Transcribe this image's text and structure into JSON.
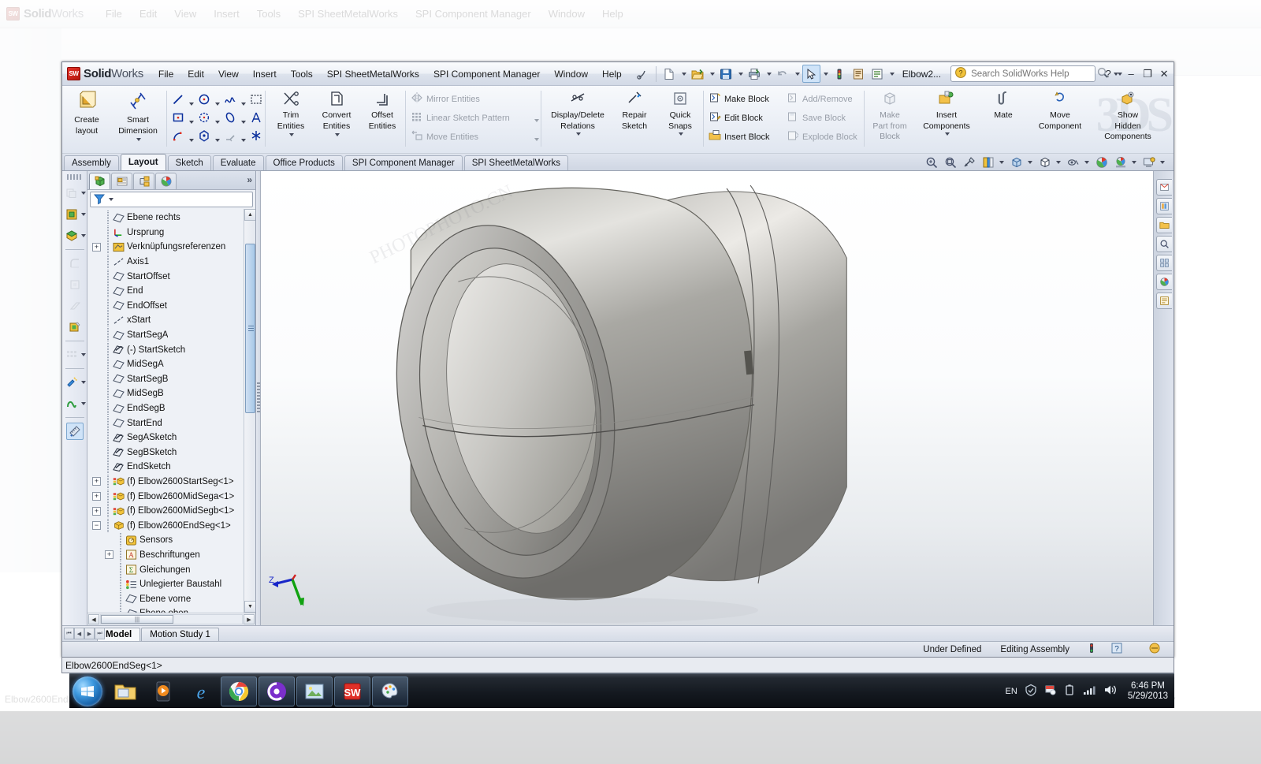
{
  "app": {
    "brand_bold": "Solid",
    "brand_light": "Works",
    "logo_badge": "SW",
    "document_name": "Elbow2...",
    "status_doc_name": "Elbow2600EndSeg<1>"
  },
  "menubar": {
    "items": [
      "File",
      "Edit",
      "View",
      "Insert",
      "Tools",
      "SPI SheetMetalWorks",
      "SPI Component Manager",
      "Window",
      "Help"
    ]
  },
  "quick_access": {
    "buttons": [
      {
        "name": "new-document",
        "icon": "new-doc-icon"
      },
      {
        "name": "open-document",
        "icon": "open-folder-icon"
      },
      {
        "name": "save-document",
        "icon": "save-disk-icon"
      },
      {
        "name": "print-document",
        "icon": "printer-icon"
      },
      {
        "name": "undo",
        "icon": "undo-arrow-icon"
      },
      {
        "name": "select",
        "icon": "cursor-arrow-icon"
      },
      {
        "name": "rebuild",
        "icon": "traffic-light-icon"
      },
      {
        "name": "options-toolbar",
        "icon": "clipboard-icon"
      },
      {
        "name": "options",
        "icon": "options-list-icon"
      }
    ]
  },
  "search": {
    "placeholder": "Search SolidWorks Help",
    "value": "",
    "icon": "help-search-icon"
  },
  "window_controls": {
    "help": "?",
    "minimize": "–",
    "restore": "❐",
    "close": "✕"
  },
  "ribbon": {
    "watermark": "3DS",
    "groups": [
      {
        "name": "layout-group",
        "big_buttons": [
          {
            "label": "Create\nlayout",
            "line1": "Create",
            "line2": "layout",
            "icon": "create-layout-icon",
            "has_caret": false
          },
          {
            "label": "Smart Dimension",
            "line1": "Smart",
            "line2": "Dimension",
            "icon": "smart-dimension-icon",
            "has_caret": true
          }
        ]
      },
      {
        "name": "sketch-entities-group",
        "grid_icons": [
          [
            "line-icon",
            "circle-icon",
            "spline-icon",
            "selection-box-icon"
          ],
          [
            "rectangle-icon",
            "polygon-arc-icon",
            "ellipse-icon",
            "text-icon"
          ],
          [
            "sketch-fillet-icon",
            "point-icon",
            "sketch-chamfer-icon",
            "sketch-pattern-star-icon"
          ]
        ]
      },
      {
        "name": "edit-entities-group",
        "big_buttons": [
          {
            "line1": "Trim",
            "line2": "Entities",
            "icon": "trim-entities-icon",
            "has_caret": true
          },
          {
            "line1": "Convert",
            "line2": "Entities",
            "icon": "convert-entities-icon",
            "has_caret": true
          },
          {
            "line1": "Offset",
            "line2": "Entities",
            "icon": "offset-entities-icon",
            "has_caret": false
          }
        ]
      },
      {
        "name": "pattern-group",
        "small_buttons": [
          {
            "label": "Mirror Entities",
            "icon": "mirror-entities-icon",
            "disabled": true,
            "caret": false
          },
          {
            "label": "Linear Sketch Pattern",
            "icon": "linear-sketch-pattern-icon",
            "disabled": true,
            "caret": true
          },
          {
            "label": "Move Entities",
            "icon": "move-entities-icon",
            "disabled": true,
            "caret": true
          }
        ]
      },
      {
        "name": "relations-group",
        "big_buttons": [
          {
            "line1": "Display/Delete",
            "line2": "Relations",
            "icon": "display-delete-relations-icon",
            "has_caret": true
          },
          {
            "line1": "Repair",
            "line2": "Sketch",
            "icon": "repair-sketch-icon",
            "has_caret": false
          },
          {
            "line1": "Quick",
            "line2": "Snaps",
            "icon": "quick-snaps-icon",
            "has_caret": true
          }
        ]
      },
      {
        "name": "blocks-group",
        "small_buttons": [
          {
            "label": "Make Block",
            "icon": "make-block-icon",
            "disabled": false
          },
          {
            "label": "Add/Remove",
            "icon": "add-remove-block-icon",
            "disabled": true
          },
          {
            "label": "Edit Block",
            "icon": "edit-block-icon",
            "disabled": false
          },
          {
            "label": "Save Block",
            "icon": "save-block-icon",
            "disabled": true
          },
          {
            "label": "Insert Block",
            "icon": "insert-block-icon",
            "disabled": false
          },
          {
            "label": "Explode Block",
            "icon": "explode-block-icon",
            "disabled": true
          }
        ]
      },
      {
        "name": "assembly-group",
        "big_buttons": [
          {
            "line1": "Make",
            "line2": "Part from",
            "line3": "Block",
            "icon": "make-part-from-block-icon",
            "has_caret": false,
            "disabled": true
          },
          {
            "line1": "Insert",
            "line2": "Components",
            "icon": "insert-components-icon",
            "has_caret": true
          },
          {
            "line1": "Mate",
            "line2": "",
            "icon": "mate-icon",
            "has_caret": false
          },
          {
            "line1": "Move",
            "line2": "Component",
            "icon": "move-component-icon",
            "has_caret": false
          },
          {
            "line1": "Show",
            "line2": "Hidden",
            "line3": "Components",
            "icon": "show-hidden-components-icon",
            "has_caret": false
          }
        ]
      }
    ]
  },
  "command_tabs": {
    "tabs": [
      {
        "label": "Assembly",
        "active": false
      },
      {
        "label": "Layout",
        "active": true
      },
      {
        "label": "Sketch",
        "active": false
      },
      {
        "label": "Evaluate",
        "active": false
      },
      {
        "label": "Office Products",
        "active": false
      },
      {
        "label": "SPI Component Manager",
        "active": false
      },
      {
        "label": "SPI SheetMetalWorks",
        "active": false
      }
    ],
    "view_toolbar_icons": [
      "zoom-to-fit-icon",
      "zoom-to-area-icon",
      "previous-view-icon",
      "section-view-icon",
      "view-orientation-icon",
      "display-style-icon",
      "hide-show-items-icon",
      "edit-appearance-icon",
      "apply-scene-icon",
      "view-settings-icon"
    ]
  },
  "left_rail": {
    "buttons": [
      {
        "name": "assembly-features-icon",
        "disabled": true,
        "caret": true
      },
      {
        "name": "reference-geometry-icon",
        "disabled": false,
        "caret": true
      },
      {
        "name": "new-motion-study-icon",
        "disabled": false,
        "caret": true
      },
      {
        "name": "fillet-icon",
        "disabled": true,
        "caret": false
      },
      {
        "name": "extrude-cut-icon",
        "disabled": true,
        "caret": false
      },
      {
        "name": "revolve-cut-icon",
        "disabled": true,
        "caret": false
      },
      {
        "name": "instant3d-icon",
        "disabled": false,
        "caret": false
      },
      {
        "name": "linear-component-pattern-icon",
        "disabled": true,
        "caret": true
      },
      {
        "name": "smart-fasteners-icon",
        "disabled": false,
        "caret": true
      },
      {
        "name": "belt-chain-icon",
        "disabled": false,
        "caret": true
      },
      {
        "name": "measure-icon",
        "disabled": false,
        "caret": false,
        "selected": true
      }
    ]
  },
  "feature_manager": {
    "tabs": [
      {
        "name": "feature-manager-design-tree-tab",
        "icon": "design-tree-icon",
        "active": true
      },
      {
        "name": "property-manager-tab",
        "icon": "property-manager-icon",
        "active": false
      },
      {
        "name": "configuration-manager-tab",
        "icon": "configuration-manager-icon",
        "active": false
      },
      {
        "name": "display-manager-tab",
        "icon": "display-manager-icon",
        "active": false
      }
    ],
    "more_tabs": "»",
    "filter_icon": "filter-funnel-icon",
    "tree": [
      {
        "label": "Ebene rechts",
        "icon": "plane-icon",
        "indent": 1,
        "expand": "none"
      },
      {
        "label": "Ursprung",
        "icon": "origin-icon",
        "indent": 1,
        "expand": "none"
      },
      {
        "label": "Verknüpfungsreferenzen",
        "icon": "mate-reference-icon",
        "indent": 1,
        "expand": "plus"
      },
      {
        "label": "Axis1",
        "icon": "axis-icon",
        "indent": 1,
        "expand": "none"
      },
      {
        "label": "StartOffset",
        "icon": "plane-icon",
        "indent": 1,
        "expand": "none"
      },
      {
        "label": "End",
        "icon": "plane-icon",
        "indent": 1,
        "expand": "none"
      },
      {
        "label": "EndOffset",
        "icon": "plane-icon",
        "indent": 1,
        "expand": "none"
      },
      {
        "label": "xStart",
        "icon": "axis-icon",
        "indent": 1,
        "expand": "none"
      },
      {
        "label": "StartSegA",
        "icon": "plane-icon",
        "indent": 1,
        "expand": "none"
      },
      {
        "label": "(-) StartSketch",
        "icon": "sketch-icon",
        "indent": 1,
        "expand": "none"
      },
      {
        "label": "MidSegA",
        "icon": "plane-icon",
        "indent": 1,
        "expand": "none"
      },
      {
        "label": "StartSegB",
        "icon": "plane-icon",
        "indent": 1,
        "expand": "none"
      },
      {
        "label": "MidSegB",
        "icon": "plane-icon",
        "indent": 1,
        "expand": "none"
      },
      {
        "label": "EndSegB",
        "icon": "plane-icon",
        "indent": 1,
        "expand": "none"
      },
      {
        "label": "StartEnd",
        "icon": "plane-icon",
        "indent": 1,
        "expand": "none"
      },
      {
        "label": "SegASketch",
        "icon": "sketch-icon",
        "indent": 1,
        "expand": "none"
      },
      {
        "label": "SegBSketch",
        "icon": "sketch-icon",
        "indent": 1,
        "expand": "none"
      },
      {
        "label": "EndSketch",
        "icon": "sketch-icon",
        "indent": 1,
        "expand": "none"
      },
      {
        "label": "(f) Elbow2600StartSeg<1>",
        "icon": "component-icon",
        "indent": 1,
        "expand": "plus"
      },
      {
        "label": "(f) Elbow2600MidSega<1>",
        "icon": "component-icon",
        "indent": 1,
        "expand": "plus"
      },
      {
        "label": "(f) Elbow2600MidSegb<1>",
        "icon": "component-icon",
        "indent": 1,
        "expand": "plus"
      },
      {
        "label": "(f) Elbow2600EndSeg<1>",
        "icon": "component-open-icon",
        "indent": 1,
        "expand": "minus"
      },
      {
        "label": "Sensors",
        "icon": "sensors-icon",
        "indent": 2,
        "expand": "none"
      },
      {
        "label": "Beschriftungen",
        "icon": "annotations-icon",
        "indent": 2,
        "expand": "plus"
      },
      {
        "label": "Gleichungen",
        "icon": "equations-icon",
        "indent": 2,
        "expand": "none"
      },
      {
        "label": "Unlegierter Baustahl",
        "icon": "material-icon",
        "indent": 2,
        "expand": "none"
      },
      {
        "label": "Ebene vorne",
        "icon": "plane-icon",
        "indent": 2,
        "expand": "none"
      },
      {
        "label": "Ebene oben",
        "icon": "plane-icon",
        "indent": 2,
        "expand": "none"
      }
    ]
  },
  "viewport": {
    "triad_labels": {
      "z": "Z",
      "x": "",
      "y": ""
    },
    "model_description": "grey shaded elbow pipe segment assembly"
  },
  "task_pane": {
    "buttons": [
      "sw-resources-icon",
      "design-library-icon",
      "file-explorer-icon",
      "search-icon",
      "view-palette-icon",
      "appearances-scenes-icon",
      "custom-properties-icon"
    ]
  },
  "bottom_tabs": {
    "nav_buttons": [
      "⏮",
      "◀",
      "▶",
      "⏭"
    ],
    "tabs": [
      {
        "label": "Model",
        "active": true
      },
      {
        "label": "Motion Study 1",
        "active": false
      }
    ]
  },
  "status_bar": {
    "left_text": "",
    "items": [
      "Under Defined",
      "Editing Assembly"
    ],
    "icons": [
      "rebuild-traffic-light-icon",
      "help-question-icon",
      "overlay-icon"
    ]
  },
  "taskbar": {
    "start": "windows-start-orb",
    "items": [
      {
        "name": "windows-explorer-icon",
        "open": false
      },
      {
        "name": "media-player-icon",
        "open": false
      },
      {
        "name": "internet-explorer-icon",
        "open": false
      },
      {
        "name": "google-chrome-icon",
        "open": true
      },
      {
        "name": "thunder-download-icon",
        "open": true
      },
      {
        "name": "photo-viewer-icon",
        "open": true
      },
      {
        "name": "solidworks-icon",
        "open": true
      },
      {
        "name": "paint-icon",
        "open": true
      }
    ],
    "tray": {
      "language": "EN",
      "icons": [
        "action-center-icon",
        "network-flag-icon",
        "battery-icon",
        "signal-bars-icon",
        "volume-icon"
      ],
      "time": "6:46 PM",
      "date": "5/29/2013"
    }
  },
  "ghost_window": {
    "status_left": "Elbow2600EndSeg<1>",
    "status_items": [
      "Under Defined",
      "Editing Assembly"
    ],
    "tray_language": "EN"
  }
}
